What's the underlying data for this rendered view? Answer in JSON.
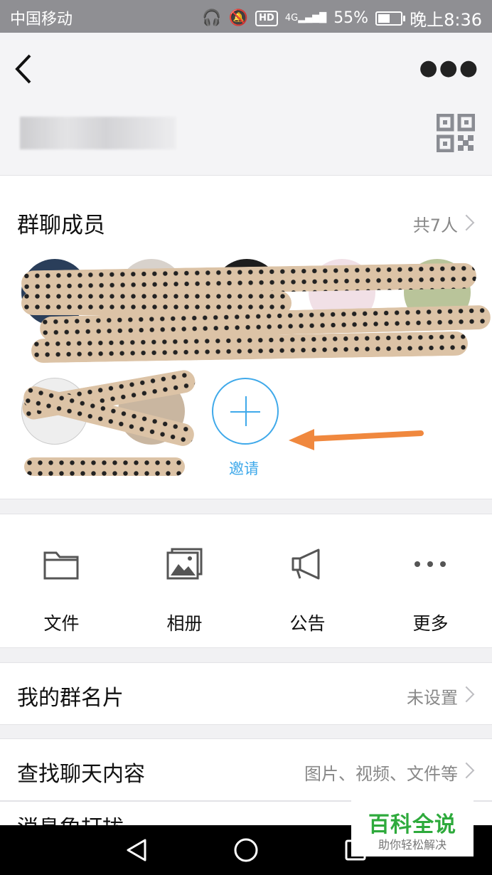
{
  "status_bar": {
    "carrier": "中国移动",
    "network": "4G",
    "battery": "55%",
    "time": "晚上8:36"
  },
  "header": {
    "back_icon": "chevron-left-icon",
    "more_icon": "more-dots-icon",
    "qr_icon": "qr-code-icon"
  },
  "members": {
    "title": "群聊成员",
    "count": "共7人",
    "invite_label": "邀请"
  },
  "actions": [
    {
      "label": "文件",
      "icon": "folder-icon"
    },
    {
      "label": "相册",
      "icon": "photo-album-icon"
    },
    {
      "label": "公告",
      "icon": "megaphone-icon"
    },
    {
      "label": "更多",
      "icon": "more-dots-icon"
    }
  ],
  "rows": {
    "card": {
      "label": "我的群名片",
      "value": "未设置"
    },
    "search": {
      "label": "查找聊天内容",
      "value": "图片、视频、文件等"
    },
    "partial": {
      "label": "消息免打扰"
    }
  },
  "watermark": {
    "title": "百科全说",
    "subtitle": "助你轻松解决"
  },
  "colors": {
    "accent": "#3fa9ea",
    "arrow": "#f0883e",
    "watermark": "#2eaa3c"
  }
}
